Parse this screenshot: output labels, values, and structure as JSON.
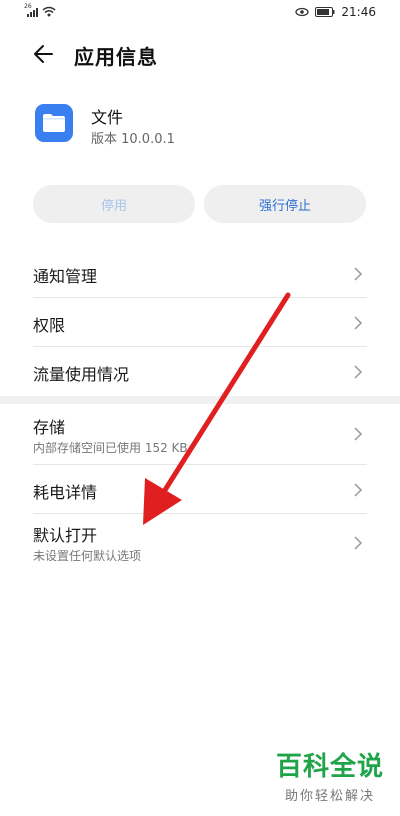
{
  "status_bar": {
    "network": "26",
    "time": "21:46"
  },
  "header": {
    "title": "应用信息"
  },
  "app": {
    "name": "文件",
    "version": "版本 10.0.0.1",
    "icon": "folder-icon",
    "icon_color": "#3a7ff0"
  },
  "actions": {
    "disable_label": "停用",
    "force_stop_label": "强行停止"
  },
  "list": {
    "notifications": "通知管理",
    "permissions": "权限",
    "data_usage": "流量使用情况",
    "storage": "存储",
    "storage_sub": "内部存储空间已使用 152 KB",
    "battery": "耗电详情",
    "default_open": "默认打开",
    "default_open_sub": "未设置任何默认选项"
  },
  "annotation": {
    "arrow_color": "#e02020"
  },
  "watermark": {
    "title": "百科全说",
    "subtitle": "助你轻松解决"
  }
}
